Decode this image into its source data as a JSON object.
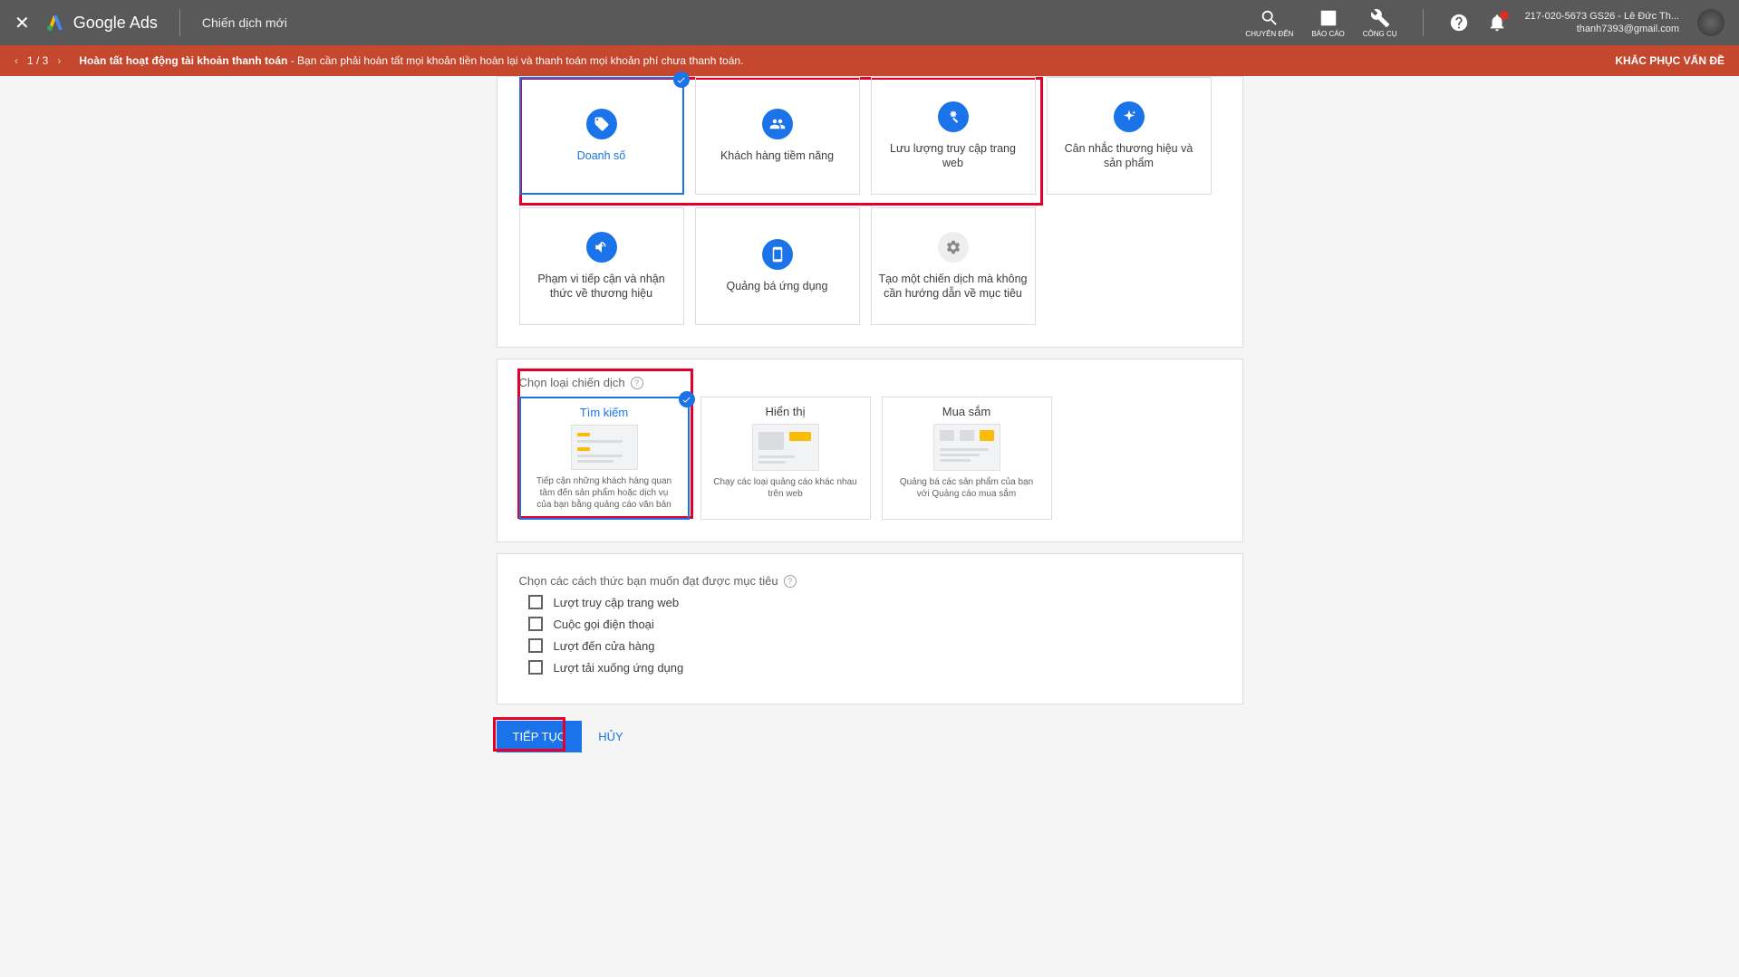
{
  "header": {
    "product": "Google Ads",
    "page_title": "Chiến dịch mới",
    "nav": {
      "search": "CHUYỂN ĐẾN",
      "reports": "BÁO CÁO",
      "tools": "CÔNG CỤ"
    },
    "account_line1": "217-020-5673 GS26 - Lê Đức Th...",
    "account_line2": "thanh7393@gmail.com"
  },
  "alert": {
    "count": "1 / 3",
    "bold": "Hoàn tất hoạt động tài khoản thanh toán",
    "rest": " - Bạn cần phải hoàn tất mọi khoản tiền hoàn lại và thanh toán mọi khoản phí chưa thanh toán.",
    "action": "KHẮC PHỤC VẤN ĐỀ"
  },
  "goals": [
    {
      "label": "Doanh số"
    },
    {
      "label": "Khách hàng tiềm năng"
    },
    {
      "label": "Lưu lượng truy cập trang web"
    },
    {
      "label": "Cân nhắc thương hiệu và sản phẩm"
    },
    {
      "label": "Phạm vi tiếp cận và nhận thức về thương hiệu"
    },
    {
      "label": "Quảng bá ứng dụng"
    },
    {
      "label": "Tạo một chiến dịch mà không cần hướng dẫn về mục tiêu"
    }
  ],
  "type_section": {
    "label": "Chọn loại chiến dịch"
  },
  "types": [
    {
      "title": "Tìm kiếm",
      "desc": "Tiếp cận những khách hàng quan tâm đến sản phẩm hoặc dịch vụ của bạn bằng quảng cáo văn bản"
    },
    {
      "title": "Hiển thị",
      "desc": "Chạy các loại quảng cáo khác nhau trên web"
    },
    {
      "title": "Mua sắm",
      "desc": "Quảng bá các sản phẩm của bạn với Quảng cáo mua sắm"
    }
  ],
  "ways_section": {
    "label": "Chọn các cách thức bạn muốn đạt được mục tiêu"
  },
  "ways": [
    "Lượt truy cập trang web",
    "Cuộc gọi điện thoại",
    "Lượt đến cửa hàng",
    "Lượt tải xuống ứng dụng"
  ],
  "actions": {
    "continue": "TIẾP TỤC",
    "cancel": "HỦY"
  }
}
